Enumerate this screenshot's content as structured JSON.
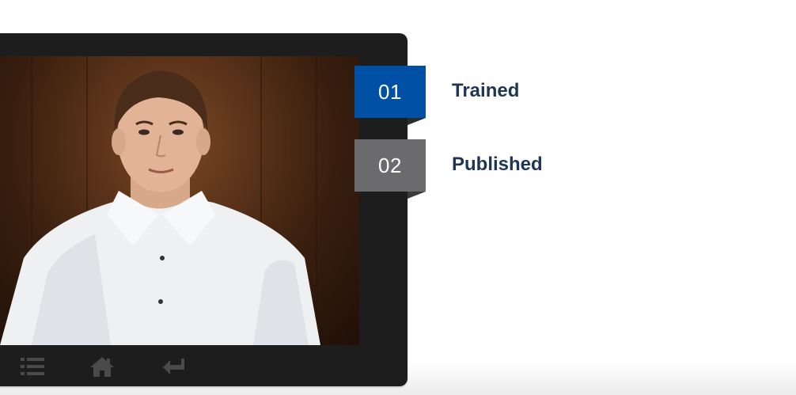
{
  "steps": [
    {
      "number": "01",
      "label": "Trained",
      "state": "active",
      "color": "#0050a6"
    },
    {
      "number": "02",
      "label": "Published",
      "state": "inactive",
      "color": "#6b6b6e"
    }
  ],
  "toolbar": {
    "icons": [
      "menu-list-icon",
      "home-icon",
      "return-icon"
    ]
  },
  "colors": {
    "frame": "#1d1d1d",
    "label_text": "#1f3554",
    "toolbar_icon": "#4a4a4a"
  }
}
